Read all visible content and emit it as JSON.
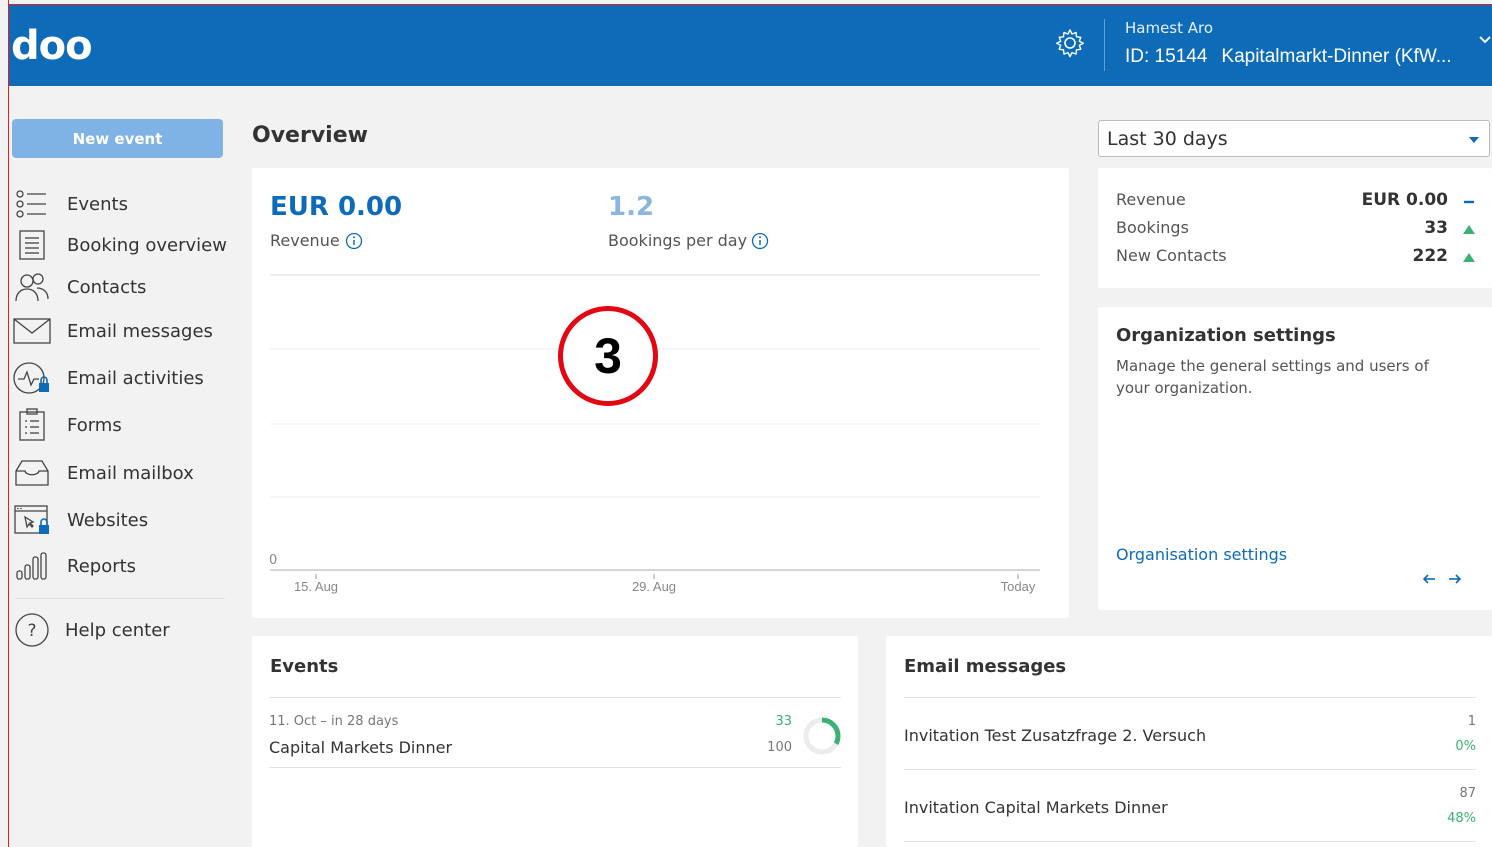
{
  "header": {
    "logo": "doo",
    "user_name": "Hamest Aro",
    "event_id": "ID: 15144",
    "event_name": "Kapitalmarkt-Dinner (KfW..."
  },
  "sidebar": {
    "new_event_label": "New event",
    "items": [
      {
        "label": "Events",
        "icon": "events-list-icon"
      },
      {
        "label": "Booking overview",
        "icon": "booking-list-icon"
      },
      {
        "label": "Contacts",
        "icon": "contacts-icon"
      },
      {
        "label": "Email messages",
        "icon": "envelope-icon"
      },
      {
        "label": "Email activities",
        "icon": "activity-lock-icon"
      },
      {
        "label": "Forms",
        "icon": "form-icon"
      },
      {
        "label": "Email mailbox",
        "icon": "inbox-icon"
      },
      {
        "label": "Websites",
        "icon": "website-lock-icon"
      },
      {
        "label": "Reports",
        "icon": "bar-chart-icon"
      }
    ],
    "help_label": "Help center"
  },
  "overview": {
    "title": "Overview",
    "period": "Last 30 days"
  },
  "kpis": {
    "revenue_value": "EUR 0.00",
    "revenue_label": "Revenue",
    "bookings_value": "1.2",
    "bookings_label": "Bookings per day"
  },
  "chart_data": {
    "type": "line",
    "title": "",
    "xlabel": "",
    "ylabel": "",
    "categories": [
      "15. Aug",
      "29. Aug",
      "Today"
    ],
    "y_ticks": [
      "0"
    ],
    "series": [],
    "grid": true
  },
  "badge": "3",
  "stats": {
    "rows": [
      {
        "label": "Revenue",
        "value": "EUR 0.00",
        "trend": "neutral"
      },
      {
        "label": "Bookings",
        "value": "33",
        "trend": "up"
      },
      {
        "label": "New Contacts",
        "value": "222",
        "trend": "up"
      }
    ],
    "colors": {
      "up": "#3bb273",
      "neutral": "#0d6bb8"
    }
  },
  "org": {
    "title": "Organization settings",
    "description": "Manage the general settings and users of your organization.",
    "link": "Organisation settings"
  },
  "events_panel": {
    "title": "Events",
    "items": [
      {
        "meta": "11. Oct – in 28 days",
        "name": "Capital Markets Dinner",
        "booked": "33",
        "capacity": "100",
        "fill": 0.33
      }
    ]
  },
  "mail_panel": {
    "title": "Email messages",
    "items": [
      {
        "name": "Invitation Test Zusatzfrage 2. Versuch",
        "count": "1",
        "pct": "0%"
      },
      {
        "name": "Invitation Capital Markets Dinner",
        "count": "87",
        "pct": "48%"
      }
    ]
  },
  "colors": {
    "primary": "#0d6bb8",
    "button": "#7fb3e6",
    "badge_ring": "#e30613"
  }
}
